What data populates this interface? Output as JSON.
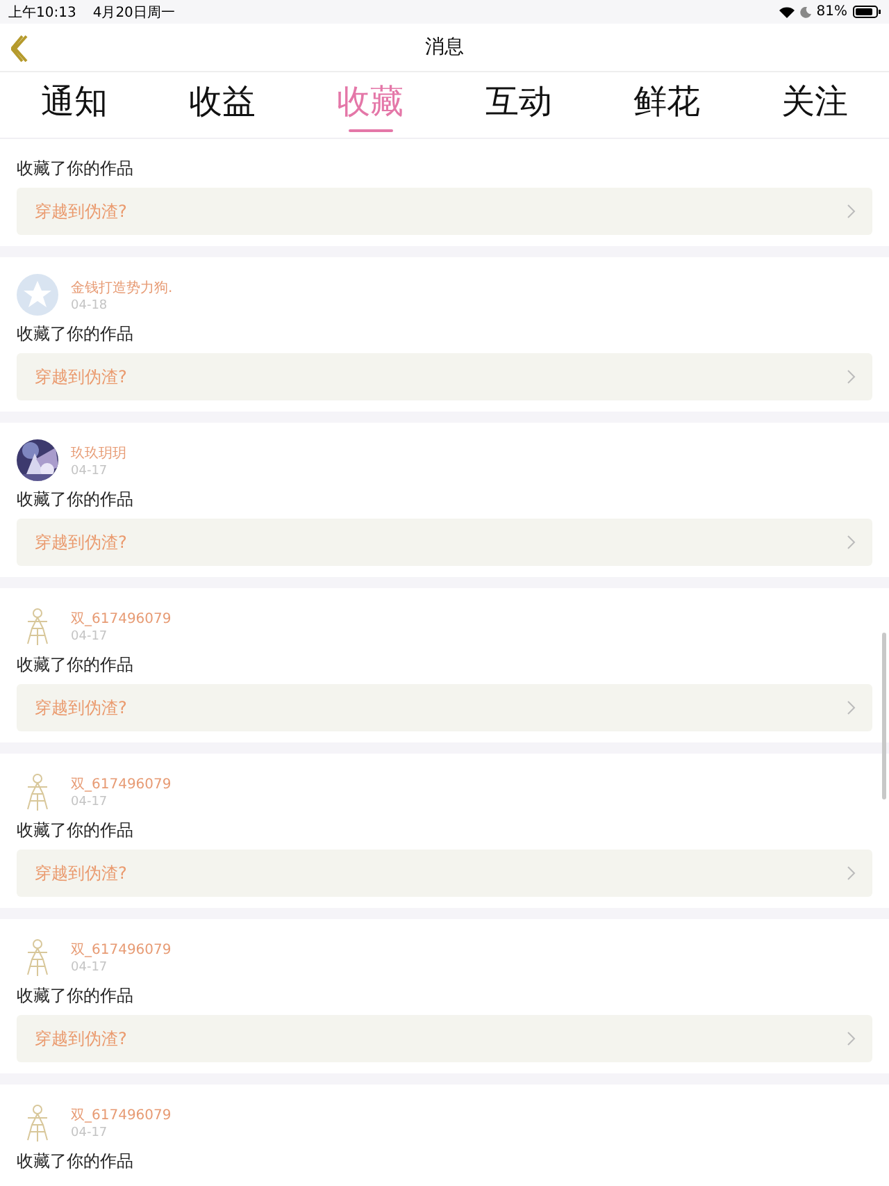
{
  "status_bar": {
    "time": "上午10:13",
    "date": "4月20日周一",
    "battery": "81%"
  },
  "nav": {
    "title": "消息"
  },
  "tabs": [
    {
      "label": "通知",
      "selected": false
    },
    {
      "label": "收益",
      "selected": false
    },
    {
      "label": "收藏",
      "selected": true
    },
    {
      "label": "互动",
      "selected": false
    },
    {
      "label": "鲜花",
      "selected": false
    },
    {
      "label": "关注",
      "selected": false
    }
  ],
  "messages": [
    {
      "text": "收藏了你的作品",
      "work": "穿越到伪渣?"
    },
    {
      "user": {
        "name": "金钱打造势力狗.",
        "avatar": {
          "kind": "default"
        }
      },
      "date": "04-18",
      "text": "收藏了你的作品",
      "work": "穿越到伪渣?"
    },
    {
      "user": {
        "name": "玖玖玥玥"
      },
      "date": "04-17",
      "text": "收藏了你的作品",
      "work": "穿越到伪渣?"
    },
    {
      "user": {
        "name": "双_617496079",
        "avatar": {
          "kind": "sketch"
        }
      },
      "date": "04-17",
      "text": "收藏了你的作品",
      "work": "穿越到伪渣?"
    },
    {
      "user": {
        "name": "双_617496079",
        "avatar": {
          "kind": "sketch"
        }
      },
      "date": "04-17",
      "text": "收藏了你的作品",
      "work": "穿越到伪渣?"
    },
    {
      "user": {
        "name": "双_617496079",
        "avatar": {
          "kind": "sketch"
        }
      },
      "date": "04-17",
      "text": "收藏了你的作品",
      "work": "穿越到伪渣?"
    },
    {
      "user": {
        "name": "双_617496079",
        "avatar": {
          "kind": "sketch"
        }
      },
      "date": "04-17",
      "text": "收藏了你的作品"
    }
  ]
}
